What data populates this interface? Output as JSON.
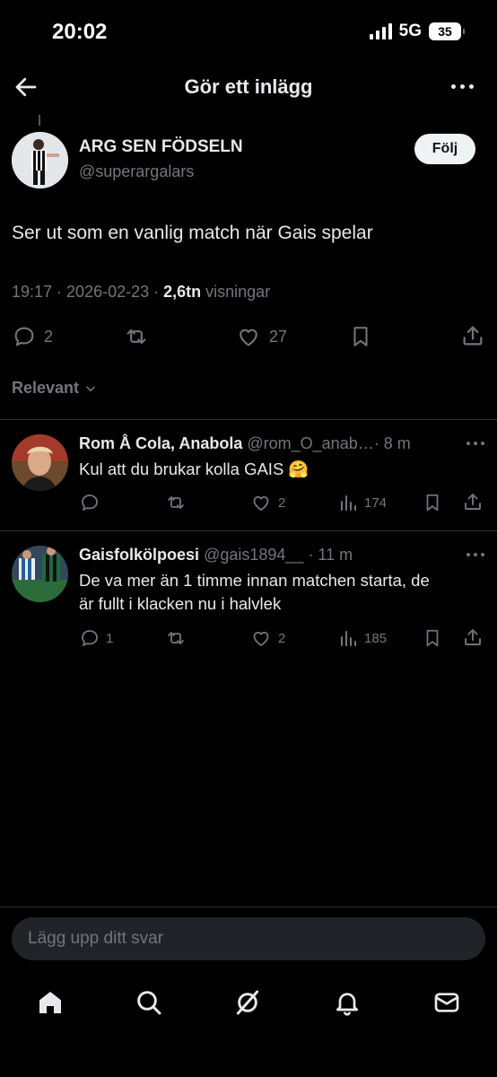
{
  "status_bar": {
    "time": "20:02",
    "network": "5G",
    "battery": "35"
  },
  "header": {
    "title": "Gör ett inlägg"
  },
  "post": {
    "author_name": "ARG SEN FÖDSELN",
    "author_handle": "@superargalars",
    "follow_label": "Följ",
    "text": "Ser ut som en vanlig match när Gais spelar",
    "time": "19:17",
    "date": "2026-02-23",
    "views_count": "2,6tn",
    "views_label": "visningar",
    "replies": "2",
    "likes": "27"
  },
  "sort": {
    "label": "Relevant"
  },
  "replies": [
    {
      "name": "Rom Å Cola, Anabola",
      "handle": "@rom_O_anab…",
      "age": "· 8 m",
      "text": "Kul att du brukar kolla GAIS 🤗",
      "replies": "",
      "likes": "2",
      "views": "174"
    },
    {
      "name": "Gaisfolkölpoesi",
      "handle": "@gais1894__",
      "age": "· 11 m",
      "text_line1": "De va mer än 1 timme innan matchen starta, de",
      "text_line2": "är fullt i klacken nu i halvlek",
      "replies": "1",
      "likes": "2",
      "views": "185"
    }
  ],
  "composer": {
    "placeholder": "Lägg upp ditt svar"
  },
  "colors": {
    "background": "#000000",
    "text": "#e7e9ea",
    "muted": "#71767b",
    "divider": "#2f3336"
  },
  "icons": [
    "back-arrow-icon",
    "more-icon",
    "reply-icon",
    "repost-icon",
    "like-icon",
    "bookmark-icon",
    "share-icon",
    "views-icon",
    "home-icon",
    "search-icon",
    "grok-icon",
    "notifications-icon",
    "messages-icon"
  ]
}
